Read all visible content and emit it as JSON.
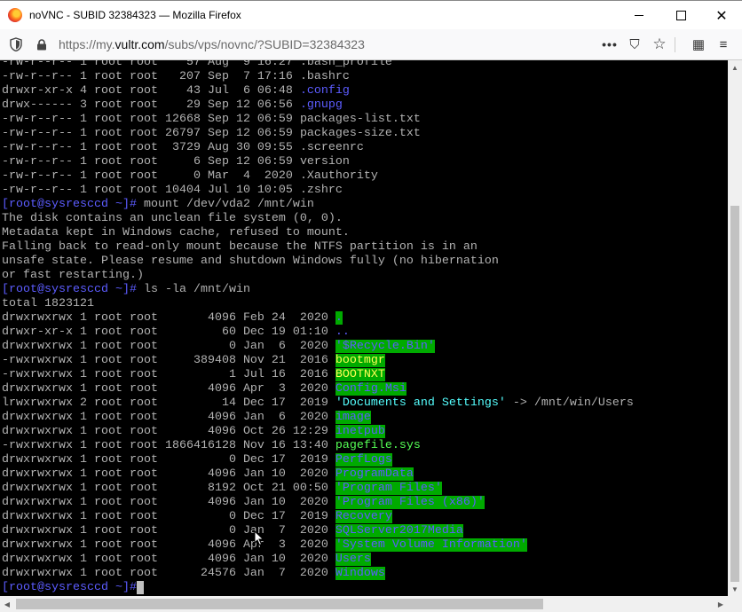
{
  "window": {
    "title": "noVNC - SUBID 32384323 — Mozilla Firefox",
    "minimize_label": "–",
    "maximize_label": "□",
    "close_label": "✕"
  },
  "navbar": {
    "url_prefix": "https://my.",
    "url_host": "vultr.com",
    "url_path": "/subs/vps/novnc/?SUBID=32384323",
    "more_label": "•••",
    "pocket_label": "⛉",
    "bookmark_label": "☆",
    "extensions_label": "▦",
    "menu_label": "≡"
  },
  "terminal": {
    "listing1": [
      [
        "-rw-r--r-- 1 root root    57 Aug  9 16:27 ",
        ".bash_profile",
        ""
      ],
      [
        "-rw-r--r-- 1 root root   207 Sep  7 17:16 ",
        ".bashrc",
        ""
      ],
      [
        "drwxr-xr-x 4 root root    43 Jul  6 06:48 ",
        ".config",
        "d"
      ],
      [
        "drwx------ 3 root root    29 Sep 12 06:56 ",
        ".gnupg",
        "d"
      ],
      [
        "-rw-r--r-- 1 root root 12668 Sep 12 06:59 ",
        "packages-list.txt",
        ""
      ],
      [
        "-rw-r--r-- 1 root root 26797 Sep 12 06:59 ",
        "packages-size.txt",
        ""
      ],
      [
        "-rw-r--r-- 1 root root  3729 Aug 30 09:55 ",
        ".screenrc",
        ""
      ],
      [
        "-rw-r--r-- 1 root root     6 Sep 12 06:59 ",
        "version",
        ""
      ],
      [
        "-rw-r--r-- 1 root root     0 Mar  4  2020 ",
        ".Xauthority",
        ""
      ],
      [
        "-rw-r--r-- 1 root root 10404 Jul 10 10:05 ",
        ".zshrc",
        ""
      ]
    ],
    "prompt": "[root@sysresccd ~]#",
    "cmd_mount": " mount /dev/vda2 /mnt/win",
    "mount_output": [
      "The disk contains an unclean file system (0, 0).",
      "Metadata kept in Windows cache, refused to mount.",
      "Falling back to read-only mount because the NTFS partition is in an",
      "unsafe state. Please resume and shutdown Windows fully (no hibernation",
      "or fast restarting.)"
    ],
    "cmd_ls": " ls -la /mnt/win",
    "total": "total 1823121",
    "listing2": [
      [
        "drwxrwxrwx 1 root root       4096 Feb 24  2020 ",
        ".",
        "g"
      ],
      [
        "drwxr-xr-x 1 root root         60 Dec 19 01:10 ",
        "..",
        "d"
      ],
      [
        "drwxrwxrwx 1 root root          0 Jan  6  2020 ",
        "'$Recycle.Bin'",
        "g"
      ],
      [
        "-rwxrwxrwx 1 root root     389408 Nov 21  2016 ",
        "bootmgr",
        "gy"
      ],
      [
        "-rwxrwxrwx 1 root root          1 Jul 16  2016 ",
        "BOOTNXT",
        "gy"
      ],
      [
        "drwxrwxrwx 1 root root       4096 Apr  3  2020 ",
        "Config.Msi",
        "g"
      ],
      [
        "lrwxrwxrwx 2 root root         14 Dec 17  2019 ",
        "'Documents and Settings'",
        "link"
      ],
      [
        "drwxrwxrwx 1 root root       4096 Jan  6  2020 ",
        "image",
        "g"
      ],
      [
        "drwxrwxrwx 1 root root       4096 Oct 26 12:29 ",
        "inetpub",
        "g"
      ],
      [
        "-rwxrwxrwx 1 root root 1866416128 Nov 16 13:40 ",
        "pagefile.sys",
        "ex"
      ],
      [
        "drwxrwxrwx 1 root root          0 Dec 17  2019 ",
        "PerfLogs",
        "g"
      ],
      [
        "drwxrwxrwx 1 root root       4096 Jan 10  2020 ",
        "ProgramData",
        "g"
      ],
      [
        "drwxrwxrwx 1 root root       8192 Oct 21 00:50 ",
        "'Program Files'",
        "g"
      ],
      [
        "drwxrwxrwx 1 root root       4096 Jan 10  2020 ",
        "'Program Files (x86)'",
        "g"
      ],
      [
        "drwxrwxrwx 1 root root          0 Dec 17  2019 ",
        "Recovery",
        "g"
      ],
      [
        "drwxrwxrwx 1 root root          0 Jan  7  2020 ",
        "SQLServer2017Media",
        "g"
      ],
      [
        "drwxrwxrwx 1 root root       4096 Apr  3  2020 ",
        "'System Volume Information'",
        "g"
      ],
      [
        "drwxrwxrwx 1 root root       4096 Jan 10  2020 ",
        "Users",
        "g"
      ],
      [
        "drwxrwxrwx 1 root root      24576 Jan  7  2020 ",
        "Windows",
        "g"
      ]
    ],
    "link_arrow": " -> ",
    "link_target": "/mnt/win/Users"
  },
  "colors": {
    "prompt": "#5c5cff",
    "dir_bg": "#00aa00",
    "text": "#b2b2b2"
  }
}
